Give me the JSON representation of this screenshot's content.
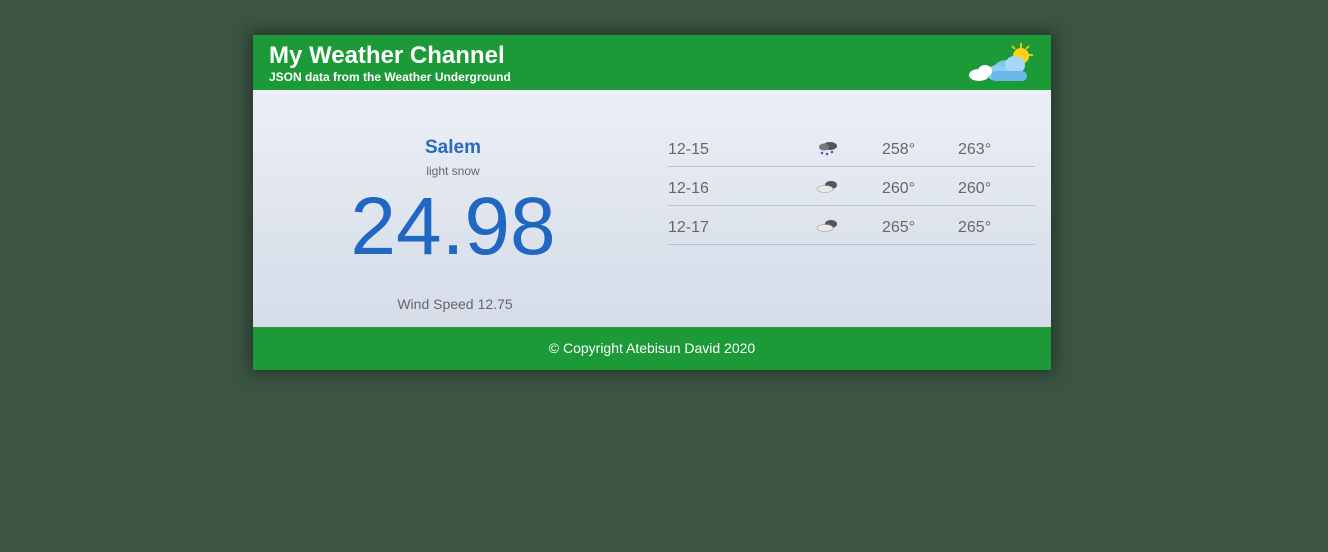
{
  "header": {
    "title": "My Weather Channel",
    "subtitle": "JSON data from the Weather Underground",
    "logo_icon": "sun-cloud-icon"
  },
  "current": {
    "city": "Salem",
    "condition": "light snow",
    "temperature": "24.98",
    "wind_label": "Wind Speed",
    "wind_value": "12.75"
  },
  "forecast": [
    {
      "date": "12-15",
      "icon": "snow-cloud-icon",
      "hi": "258°",
      "lo": "263°"
    },
    {
      "date": "12-16",
      "icon": "cloud-icon",
      "hi": "260°",
      "lo": "260°"
    },
    {
      "date": "12-17",
      "icon": "cloud-icon",
      "hi": "265°",
      "lo": "265°"
    }
  ],
  "footer": {
    "copyright": "© Copyright Atebisun David 2020"
  },
  "colors": {
    "background": "#3b5443",
    "brand_green": "#1b9a37",
    "accent_blue": "#2067c2"
  }
}
